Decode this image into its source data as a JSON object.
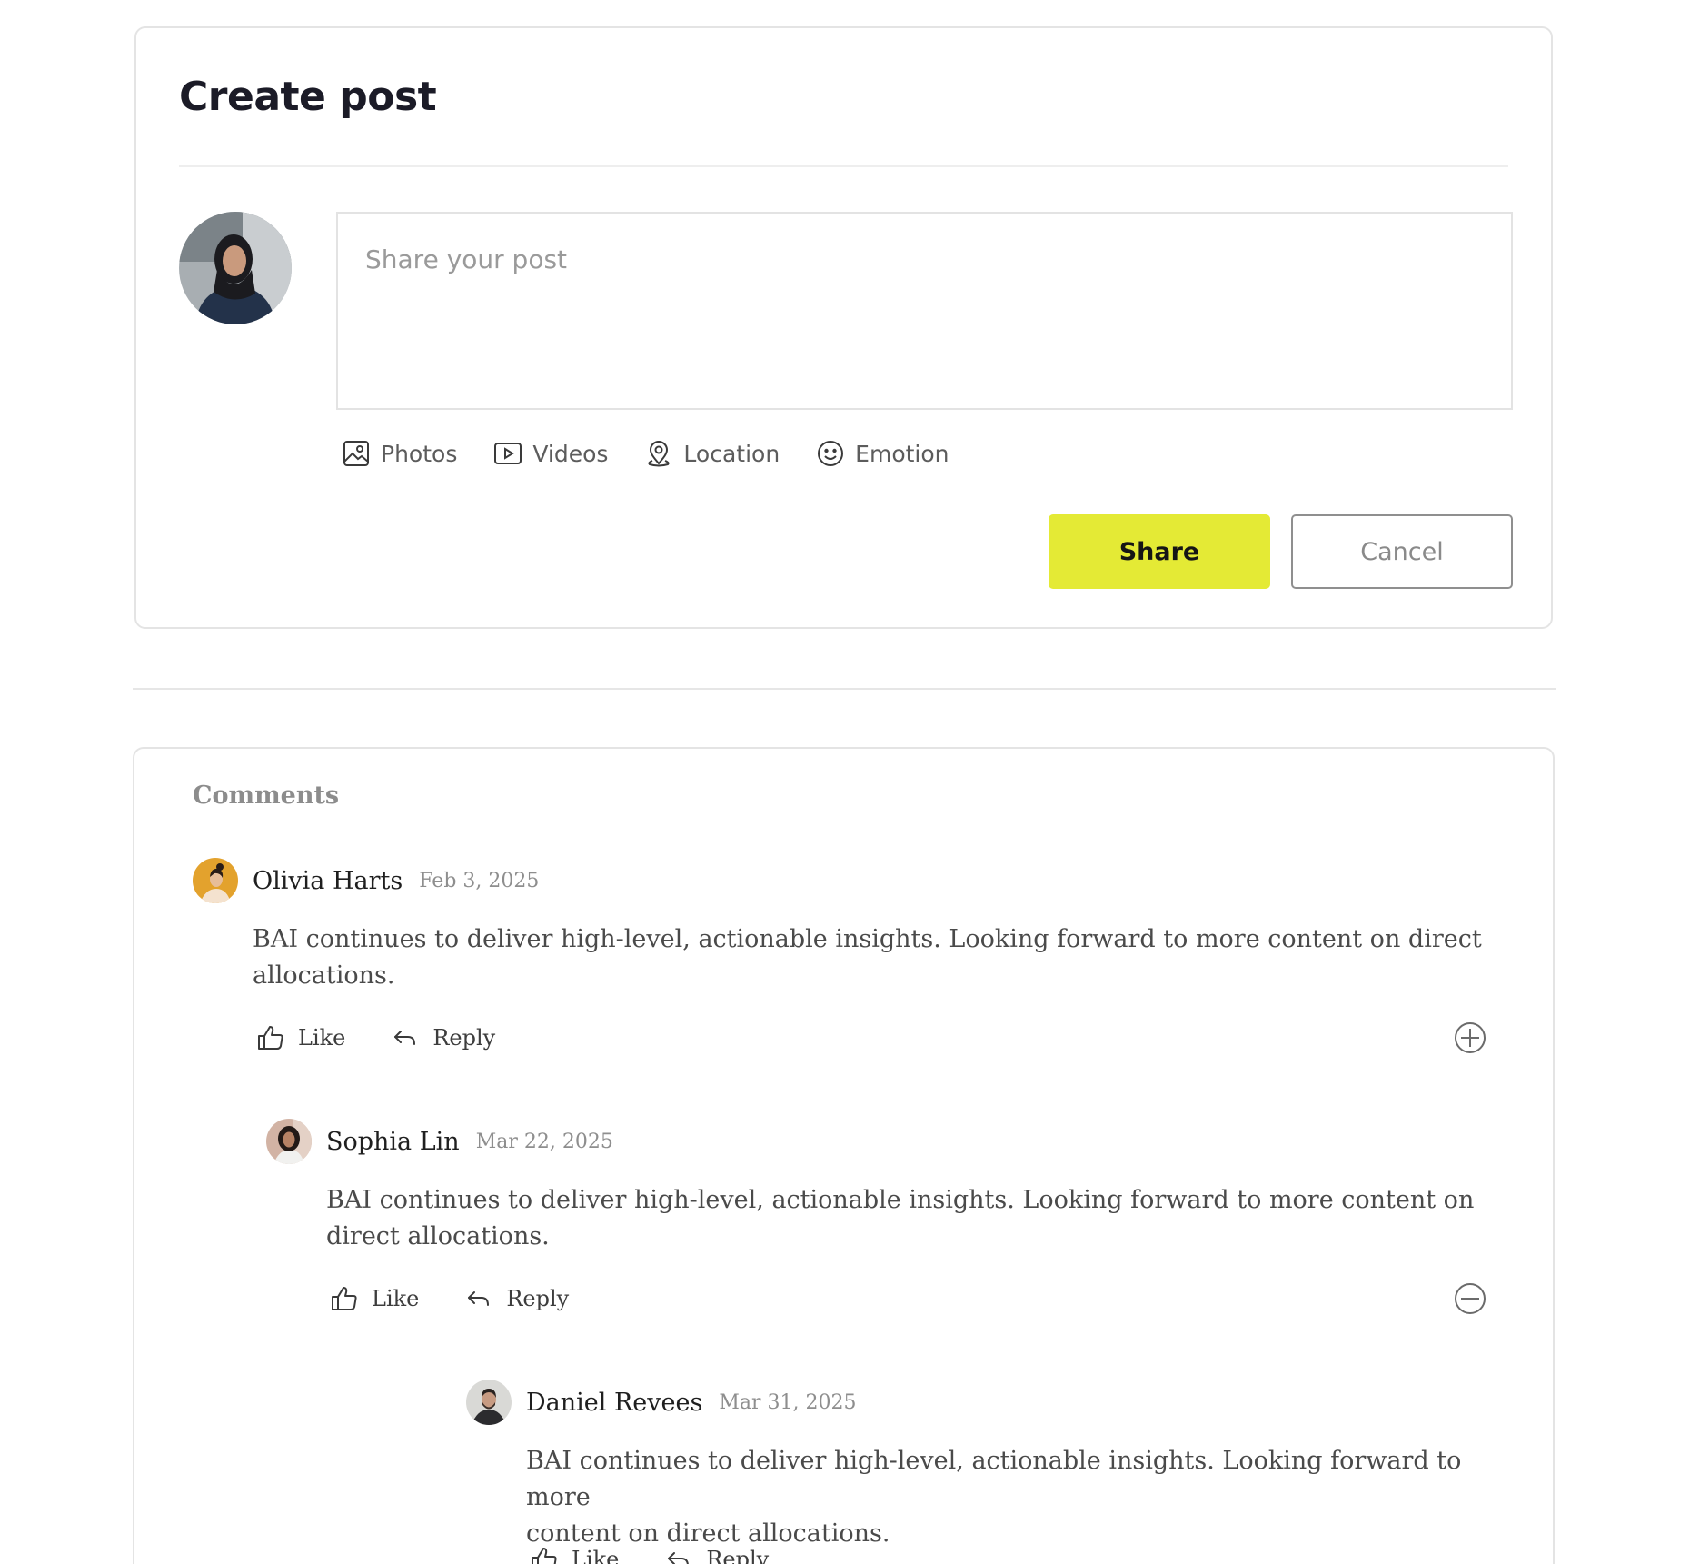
{
  "composer": {
    "title": "Create post",
    "placeholder": "Share your post",
    "attachments": [
      {
        "label": "Photos",
        "icon": "photo-icon"
      },
      {
        "label": "Videos",
        "icon": "video-icon"
      },
      {
        "label": "Location",
        "icon": "location-pin-icon"
      },
      {
        "label": "Emotion",
        "icon": "smiley-icon"
      }
    ],
    "share_label": "Share",
    "cancel_label": "Cancel",
    "accent_color": "#e4ea35"
  },
  "comments": {
    "title": "Comments",
    "items": [
      {
        "author": "Olivia Harts",
        "date": "Feb 3, 2025",
        "body_lines": [
          "BAI continues to deliver high-level, actionable insights. Looking forward to more content on direct",
          "allocations."
        ],
        "like_label": "Like",
        "reply_label": "Reply",
        "toggle_icon": "plus-circle-icon"
      },
      {
        "author": "Sophia Lin",
        "date": "Mar 22, 2025",
        "body_lines": [
          "BAI continues to deliver high-level, actionable insights. Looking forward to more content on",
          "direct allocations."
        ],
        "like_label": "Like",
        "reply_label": "Reply",
        "toggle_icon": "minus-circle-icon"
      },
      {
        "author": "Daniel Revees",
        "date": "Mar 31, 2025",
        "body_lines": [
          "BAI continues to deliver high-level, actionable insights. Looking forward to more",
          "content on direct allocations."
        ],
        "like_label": "Like",
        "reply_label": "Reply"
      }
    ]
  }
}
